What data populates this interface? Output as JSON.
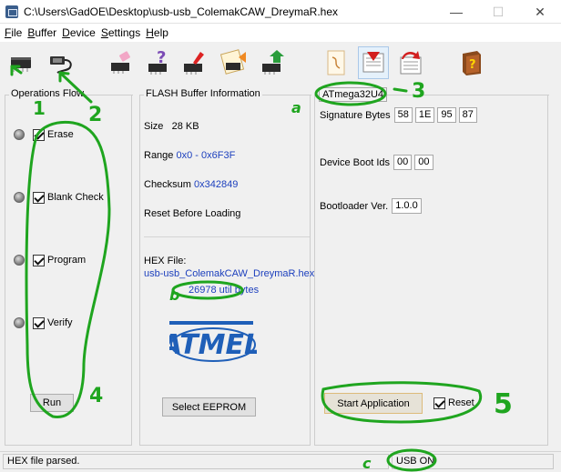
{
  "window": {
    "title": "C:\\Users\\GadOE\\Desktop\\usb-usb_ColemakCAW_DreymaR.hex",
    "minimize": "—",
    "maximize": "☐",
    "close": "✕"
  },
  "menu": [
    "File",
    "Buffer",
    "Device",
    "Settings",
    "Help"
  ],
  "toolbar": {
    "icons": [
      "chip-icon",
      "usb-cable-icon",
      "erase-chip-icon",
      "blank-check-chip-icon",
      "program-chip-icon",
      "load-chip-icon",
      "verify-chip-icon",
      "edit-document-icon",
      "load-file-icon",
      "save-file-icon",
      "help-book-icon"
    ]
  },
  "operations_flow": {
    "title": "Operations Flow",
    "items": [
      {
        "label": "Erase",
        "checked": true
      },
      {
        "label": "Blank Check",
        "checked": true
      },
      {
        "label": "Program",
        "checked": true
      },
      {
        "label": "Verify",
        "checked": true
      }
    ],
    "run_label": "Run"
  },
  "flash_info": {
    "title": "FLASH Buffer Information",
    "size_label": "Size",
    "size_value": "28 KB",
    "range_label": "Range",
    "range_value": "0x0 - 0x6F3F",
    "checksum_label": "Checksum",
    "checksum_value": "0x342849",
    "reset_before_loading": "Reset Before Loading",
    "hex_file_label": "HEX File:",
    "hex_file_name": "usb-usb_ColemakCAW_DreymaR.hex",
    "bytes_value": "26978",
    "bytes_suffix": "util bytes",
    "logo_text": "ATMEL",
    "eeprom_button": "Select EEPROM"
  },
  "device_info": {
    "device_name": "ATmega32U4",
    "signature_label": "Signature Bytes",
    "signature_bytes": [
      "58",
      "1E",
      "95",
      "87"
    ],
    "boot_ids_label": "Device Boot Ids",
    "boot_ids": [
      "00",
      "00"
    ],
    "bootloader_label": "Bootloader Ver.",
    "bootloader_value": "1.0.0",
    "start_app_button": "Start Application",
    "reset_label": "Reset",
    "reset_checked": true
  },
  "status": {
    "message": "HEX file parsed.",
    "connection": "USB ON"
  },
  "annotations": [
    "1",
    "2",
    "3",
    "4",
    "5",
    "a",
    "b",
    "c"
  ],
  "colors": {
    "annotation_green": "#1fa51f",
    "link_blue": "#1c3fbd",
    "atmel_blue": "#1f5fb8"
  }
}
